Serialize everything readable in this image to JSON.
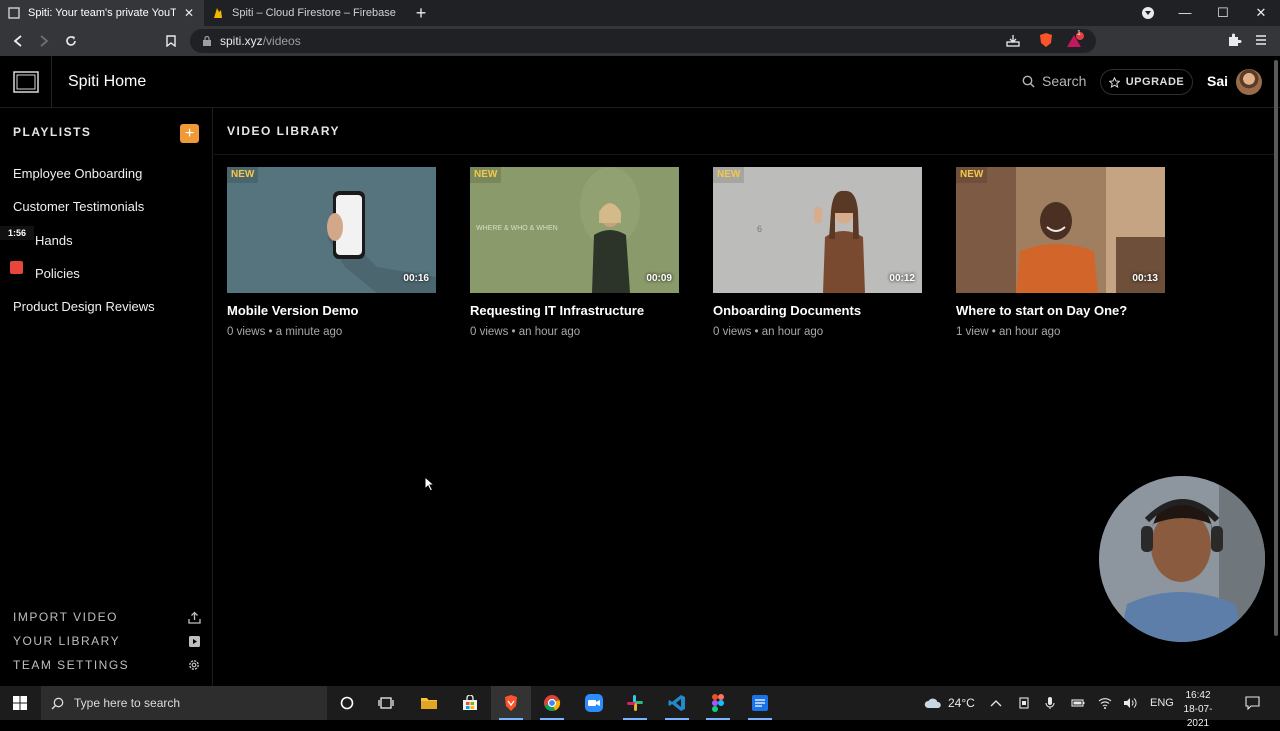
{
  "browser": {
    "tabs": [
      {
        "title": "Spiti: Your team's private YouTube",
        "active": true
      },
      {
        "title": "Spiti – Cloud Firestore – Firebase cons",
        "active": false
      }
    ],
    "url_host": "spiti.xyz",
    "url_path": "/videos",
    "extension_badge": "1"
  },
  "header": {
    "app_title": "Spiti Home",
    "search_label": "Search",
    "upgrade_label": "UPGRADE",
    "user_name": "Sai"
  },
  "sidebar": {
    "heading": "PLAYLISTS",
    "add_label": "+",
    "items": [
      {
        "label": "Employee Onboarding"
      },
      {
        "label": "Customer Testimonials"
      },
      {
        "label": "Hands"
      },
      {
        "label": "Policies"
      },
      {
        "label": "Product Design Reviews"
      }
    ],
    "bottom": [
      {
        "label": "IMPORT VIDEO",
        "icon": "upload-icon"
      },
      {
        "label": "YOUR LIBRARY",
        "icon": "library-icon"
      },
      {
        "label": "TEAM SETTINGS",
        "icon": "gear-icon"
      }
    ]
  },
  "recorder": {
    "elapsed": "1:56"
  },
  "main": {
    "title": "VIDEO LIBRARY",
    "videos": [
      {
        "badge": "NEW",
        "duration": "00:16",
        "title": "Mobile Version Demo",
        "meta": "0 views • a minute ago",
        "bg": "#4f6c76"
      },
      {
        "badge": "NEW",
        "duration": "00:09",
        "title": "Requesting IT Infrastructure",
        "meta": "0 views • an hour ago",
        "bg": "#8a9a6a",
        "overlay_text": "WHERE & WHO & WHEN"
      },
      {
        "badge": "NEW",
        "duration": "00:12",
        "title": "Onboarding Documents",
        "meta": "0 views • an hour ago",
        "bg": "#b8b8b6",
        "overlay_text": "6"
      },
      {
        "badge": "NEW",
        "duration": "00:13",
        "title": "Where to start on Day One?",
        "meta": "1 view • an hour ago",
        "bg": "#9a7a5c"
      }
    ]
  },
  "taskbar": {
    "search_placeholder": "Type here to search",
    "weather": "24°C",
    "language": "ENG",
    "time": "16:42",
    "date": "18-07-2021"
  },
  "colors": {
    "accent": "#f09a37",
    "new_badge": "#f2c94c"
  }
}
